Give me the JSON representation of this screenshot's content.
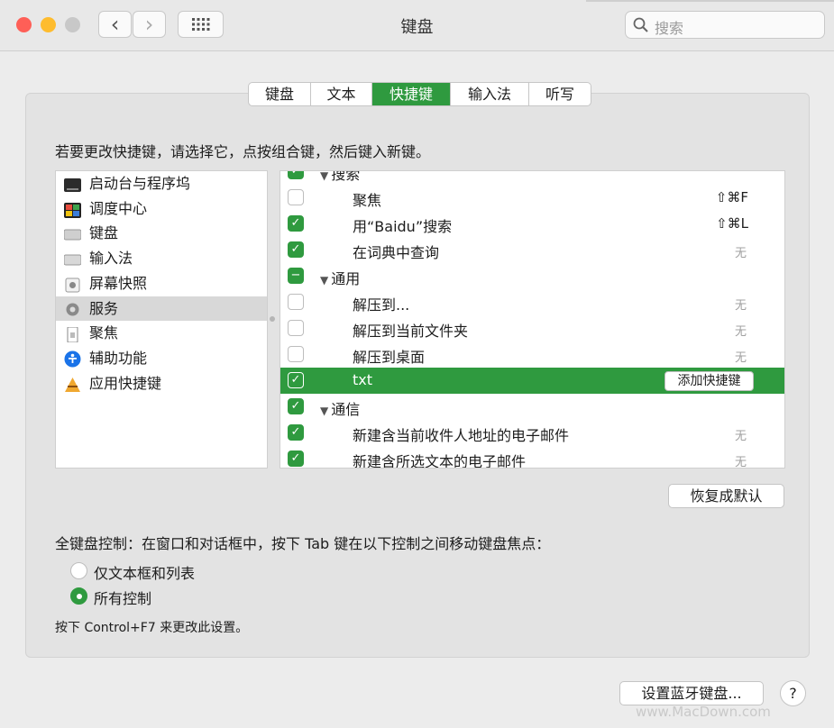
{
  "window": {
    "title": "键盘",
    "search_placeholder": "搜索",
    "back_icon": "‹",
    "forward_icon": "›",
    "grid_icon": "⋮⋮⋮"
  },
  "tabs": [
    {
      "label": "键盘",
      "active": false
    },
    {
      "label": "文本",
      "active": false
    },
    {
      "label": "快捷键",
      "active": true
    },
    {
      "label": "输入法",
      "active": false
    },
    {
      "label": "听写",
      "active": false
    }
  ],
  "instruction": "若要更改快捷键，请选择它，点按组合键，然后键入新键。",
  "categories": [
    {
      "label": "启动台与程序坞",
      "icon": "launchpad-dock-icon",
      "selected": false
    },
    {
      "label": "调度中心",
      "icon": "mission-control-icon",
      "selected": false
    },
    {
      "label": "键盘",
      "icon": "keyboard-icon",
      "selected": false
    },
    {
      "label": "输入法",
      "icon": "input-source-icon",
      "selected": false
    },
    {
      "label": "屏幕快照",
      "icon": "screenshot-icon",
      "selected": false
    },
    {
      "label": "服务",
      "icon": "services-gear-icon",
      "selected": true
    },
    {
      "label": "聚焦",
      "icon": "spotlight-icon",
      "selected": false
    },
    {
      "label": "辅助功能",
      "icon": "accessibility-icon",
      "selected": false
    },
    {
      "label": "应用快捷键",
      "icon": "app-shortcuts-icon",
      "selected": false
    }
  ],
  "shortcuts": [
    {
      "kind": "group",
      "label": "搜索",
      "check": "on"
    },
    {
      "kind": "item",
      "label": "聚焦",
      "check": "off",
      "shortcut": "⇧⌘F"
    },
    {
      "kind": "item",
      "label": "用“Baidu”搜索",
      "check": "on",
      "shortcut": "⇧⌘L"
    },
    {
      "kind": "item",
      "label": "在词典中查询",
      "check": "on",
      "shortcut": "无"
    },
    {
      "kind": "group",
      "label": "通用",
      "check": "mixed"
    },
    {
      "kind": "item",
      "label": "解压到...",
      "check": "off",
      "shortcut": "无"
    },
    {
      "kind": "item",
      "label": "解压到当前文件夹",
      "check": "off",
      "shortcut": "无"
    },
    {
      "kind": "item",
      "label": "解压到桌面",
      "check": "off",
      "shortcut": "无"
    },
    {
      "kind": "item",
      "label": "txt",
      "check": "on",
      "shortcut": "",
      "selected": true,
      "button": "添加快捷键"
    },
    {
      "kind": "group",
      "label": "通信",
      "check": "on"
    },
    {
      "kind": "item",
      "label": "新建含当前收件人地址的电子邮件",
      "check": "on",
      "shortcut": "无"
    },
    {
      "kind": "item",
      "label": "新建含所选文本的电子邮件",
      "check": "on",
      "shortcut": "无"
    }
  ],
  "restore_defaults": "恢复成默认",
  "keyboard_control": {
    "label": "全键盘控制：在窗口和对话框中，按下 Tab 键在以下控制之间移动键盘焦点：",
    "options": [
      {
        "label": "仅文本框和列表",
        "selected": false
      },
      {
        "label": "所有控制",
        "selected": true
      }
    ],
    "note": "按下 Control+F7 来更改此设置。"
  },
  "bluetooth_button": "设置蓝牙键盘...",
  "help_label": "?",
  "watermark": "www.MacDown.com",
  "colors": {
    "accent": "#2f9a3f",
    "close": "#fe5f57",
    "minimize": "#febc2e",
    "zoom": "#c8c8c8"
  }
}
